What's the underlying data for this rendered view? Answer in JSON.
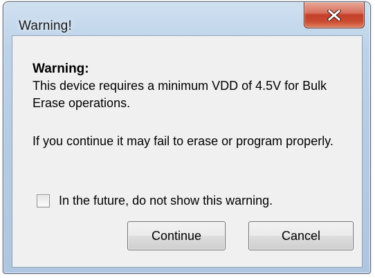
{
  "window": {
    "title": "Warning!"
  },
  "message": {
    "heading": "Warning:",
    "line1": "This device requires a minimum VDD of 4.5V for Bulk Erase operations.",
    "line2": "If you continue it may fail to erase or program properly."
  },
  "checkbox": {
    "label": "In the future, do not show this warning.",
    "checked": false
  },
  "buttons": {
    "continue_label": "Continue",
    "cancel_label": "Cancel"
  },
  "icons": {
    "close": "close-icon"
  },
  "colors": {
    "close_button": "#c94a30",
    "client_bg": "#f0f0f0"
  }
}
